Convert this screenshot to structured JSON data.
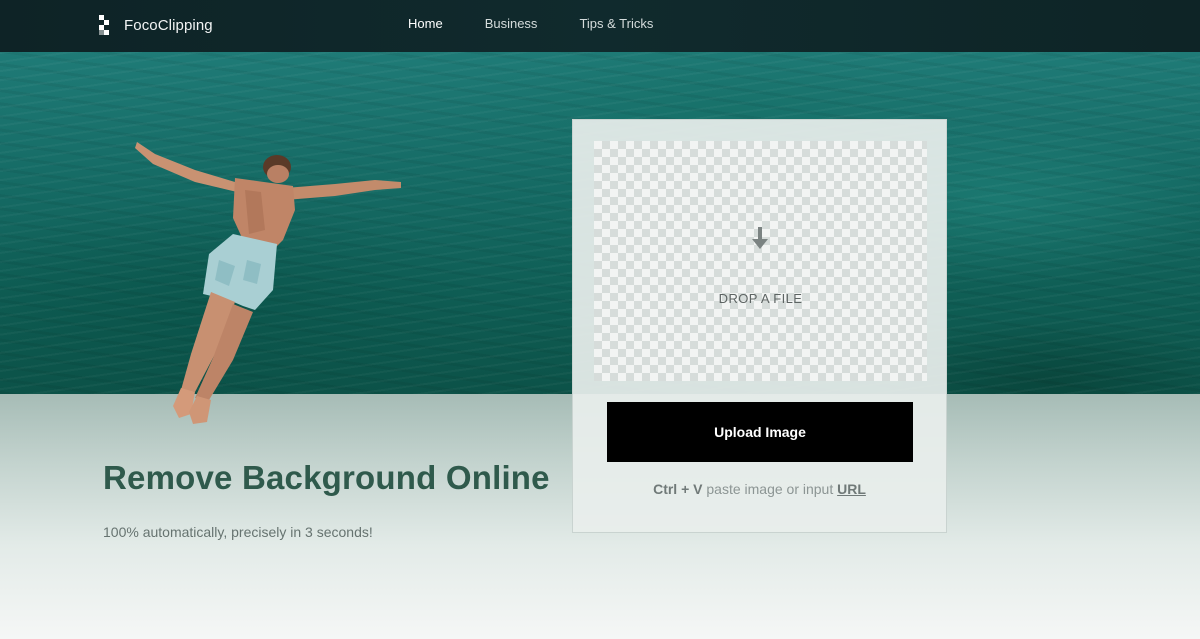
{
  "brand": {
    "logo_icon": "fococlipping-logo-icon",
    "name": "FocoClipping"
  },
  "nav": {
    "items": [
      {
        "label": "Home",
        "active": true
      },
      {
        "label": "Business",
        "active": false
      },
      {
        "label": "Tips & Tricks",
        "active": false
      }
    ]
  },
  "hero": {
    "headline": "Remove Background Online",
    "subline": "100% automatically, precisely in 3 seconds!"
  },
  "upload": {
    "drop_icon": "arrow-down-icon",
    "drop_label": "DROP A FILE",
    "button_label": "Upload Image",
    "paste_shortcut": "Ctrl + V",
    "paste_text": "paste image or input",
    "url_link": "URL"
  },
  "colors": {
    "header_bg": "#0e2326",
    "headline": "#2f5a4c",
    "button_bg": "#000000",
    "water": "#166c66"
  }
}
